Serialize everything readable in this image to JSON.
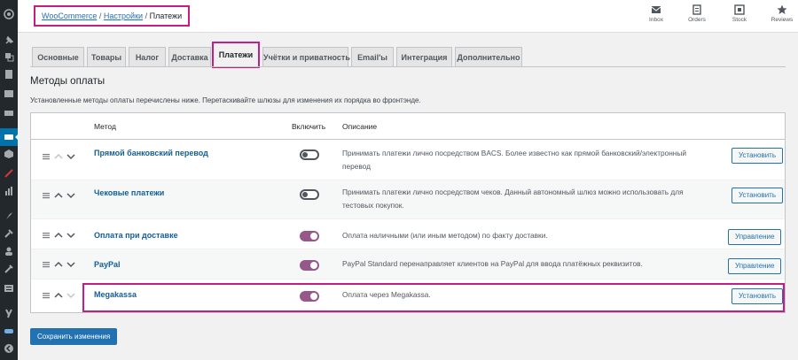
{
  "breadcrumb": {
    "root": "WooCommerce",
    "settings": "Настройки",
    "current": "Платежи",
    "sep": "/"
  },
  "toolbar": [
    {
      "label": "Inbox",
      "icon": "inbox-icon"
    },
    {
      "label": "Orders",
      "icon": "orders-icon"
    },
    {
      "label": "Stock",
      "icon": "stock-icon"
    },
    {
      "label": "Reviews",
      "icon": "star-icon"
    }
  ],
  "tabs": [
    "Основные",
    "Товары",
    "Налог",
    "Доставка",
    "Платежи",
    "Учётки и приватность",
    "Email'ы",
    "Интеграция",
    "Дополнительно"
  ],
  "active_tab": "Платежи",
  "section": {
    "title": "Методы оплаты",
    "desc": "Установленные методы оплаты перечислены ниже. Перетаскивайте шлюзы для изменения их порядка во фронтэнде."
  },
  "table": {
    "headers": {
      "method": "Метод",
      "enable": "Включить",
      "description": "Описание"
    },
    "rows": [
      {
        "name": "Прямой банковский перевод",
        "enabled": false,
        "desc": "Принимать платежи лично посредством BACS. Более известно как прямой банковский/электронный перевод",
        "action": "Установить"
      },
      {
        "name": "Чековые платежи",
        "enabled": false,
        "desc": "Принимать платежи лично посредством чеков. Данный автономный шлюз можно использовать для тестовых покупок.",
        "action": "Установить"
      },
      {
        "name": "Оплата при доставке",
        "enabled": true,
        "desc": "Оплата наличными (или иным методом) по факту доставки.",
        "action": "Управление"
      },
      {
        "name": "PayPal",
        "enabled": true,
        "desc": "PayPal Standard перенаправляет клиентов на PayPal для ввода платёжных реквизитов.",
        "action": "Управление"
      },
      {
        "name": "Megakassa",
        "enabled": true,
        "desc": "Оплата через Megakassa.",
        "action": "Установить"
      }
    ]
  },
  "save_label": "Сохранить изменения",
  "colors": {
    "accent": "#2271b1",
    "highlight": "#c41e85",
    "toggle_on": "#96588a",
    "sidebar": "#23282d"
  }
}
